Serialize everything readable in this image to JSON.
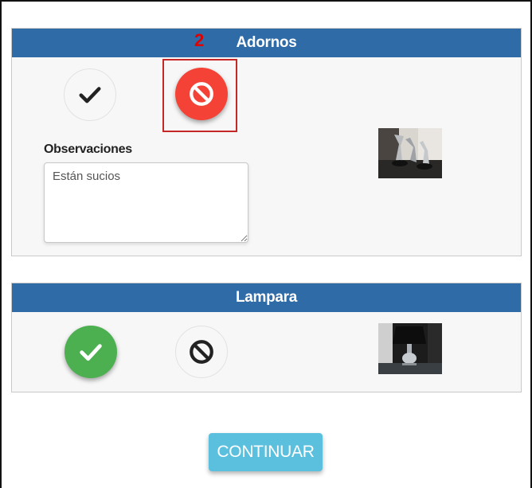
{
  "sections": [
    {
      "title": "Adornos",
      "step_marker": "2",
      "observations_label": "Observaciones",
      "observations_value": "Están sucios",
      "selected": "reject",
      "image_icon": "photo-figurines"
    },
    {
      "title": "Lampara",
      "selected": "approve",
      "image_icon": "photo-lamp"
    }
  ],
  "continue_label": "CONTINUAR",
  "colors": {
    "header": "#2f6ba6",
    "reject": "#f44336",
    "approve": "#4caf50",
    "continue": "#5bc0de",
    "highlight": "#c62828"
  }
}
